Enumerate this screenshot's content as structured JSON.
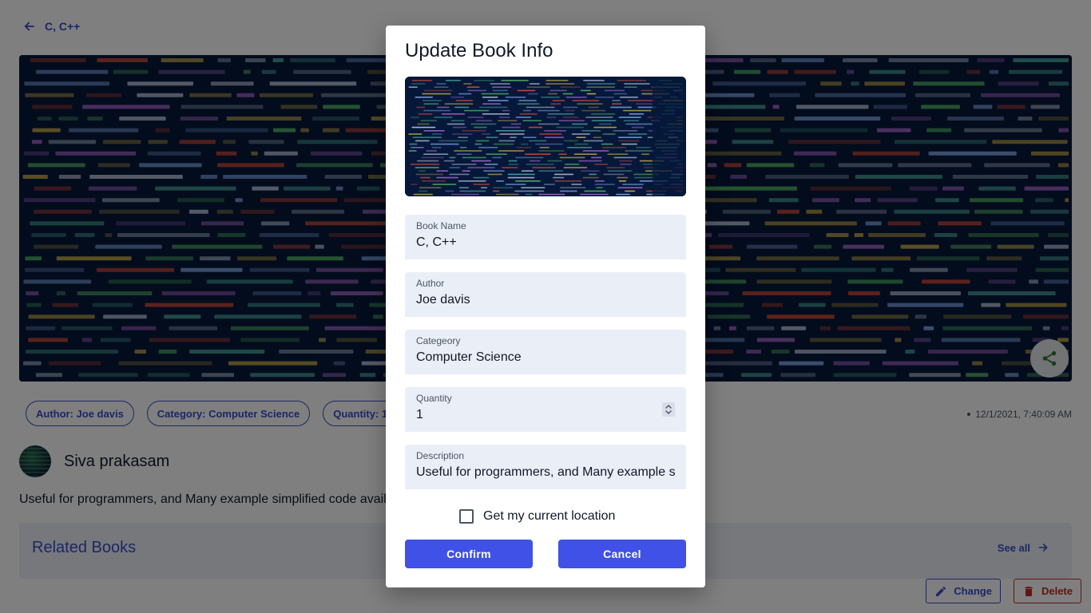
{
  "page": {
    "back_label": "C, C++",
    "chips": [
      "Author: Joe davis",
      "Category: Computer Science",
      "Quantity: 1"
    ],
    "timestamp": "12/1/2021, 7:40:09 AM",
    "user_name": "Siva prakasam",
    "description": "Useful for programmers, and Many example simplified code available.",
    "related_title": "Related Books",
    "see_all_label": "See all",
    "change_label": "Change",
    "delete_label": "Delete",
    "icons": {
      "back": "arrow-left-icon",
      "share": "share-icon",
      "see_all": "arrow-right-icon",
      "change": "pencil-icon",
      "delete": "trash-icon"
    }
  },
  "dialog": {
    "title": "Update Book Info",
    "fields": {
      "book_name": {
        "label": "Book Name",
        "value": "C, C++"
      },
      "author": {
        "label": "Author",
        "value": "Joe davis"
      },
      "category": {
        "label": "Categeory",
        "value": "Computer Science"
      },
      "quantity": {
        "label": "Quantity",
        "value": "1"
      },
      "description": {
        "label": "Description",
        "value": "Useful for programmers, and Many example simplified code available."
      }
    },
    "location_checkbox_label": "Get my current location",
    "location_checked": false,
    "confirm_label": "Confirm",
    "cancel_label": "Cancel"
  },
  "colors": {
    "accent": "#3f51e6",
    "link": "#3b4cca",
    "danger": "#c62828",
    "field_bg": "#eaeef7"
  }
}
